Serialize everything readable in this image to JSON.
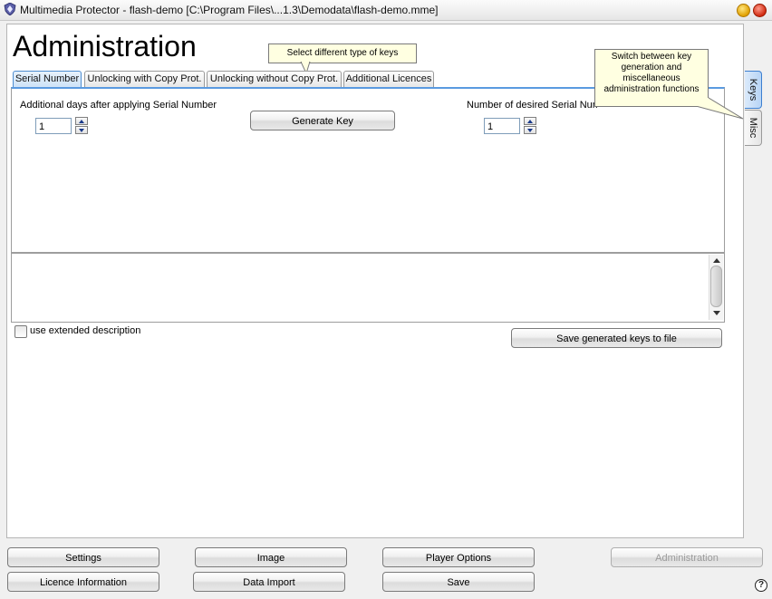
{
  "window": {
    "title": "Multimedia Protector - flash-demo [C:\\Program Files\\...1.3\\Demodata\\flash-demo.mme]"
  },
  "page": {
    "title": "Administration"
  },
  "tooltips": {
    "key_types": "Select different type of keys",
    "side_tabs": "Switch between key generation and miscellaneous administration functions"
  },
  "tabs": [
    {
      "label": "Serial Number",
      "active": true
    },
    {
      "label": "Unlocking with Copy Prot.",
      "active": false
    },
    {
      "label": "Unlocking without Copy Prot.",
      "active": false
    },
    {
      "label": "Additional Licences",
      "active": false
    }
  ],
  "serial_panel": {
    "days_label": "Additional days after applying Serial Number",
    "days_value": "1",
    "count_label": "Number of desired Serial Numbers",
    "count_value": "1",
    "generate_button": "Generate Key"
  },
  "output": {
    "text": ""
  },
  "extended_description": {
    "label": "use extended description",
    "checked": false
  },
  "save_keys_button": "Save generated keys to file",
  "side_tabs": [
    {
      "label": "Keys",
      "active": true
    },
    {
      "label": "Misc",
      "active": false
    }
  ],
  "bottom_buttons": {
    "settings": "Settings",
    "image": "Image",
    "player_options": "Player Options",
    "administration": "Administration",
    "licence_information": "Licence Information",
    "data_import": "Data Import",
    "save": "Save"
  },
  "help": "?"
}
